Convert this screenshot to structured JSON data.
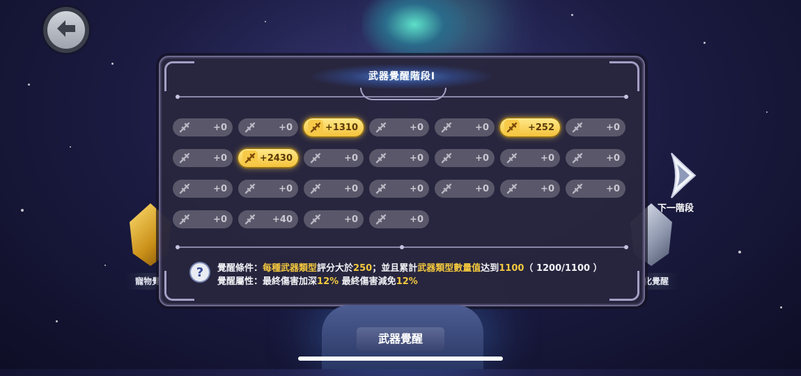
{
  "header": {
    "back_icon": "back-arrow-icon"
  },
  "panel": {
    "title": "武器覺醒階段I",
    "weapons": [
      {
        "icon": "sword-icon",
        "value": "+0",
        "active": false
      },
      {
        "icon": "dual-blades-icon",
        "value": "+0",
        "active": false
      },
      {
        "icon": "whip-icon",
        "value": "+1310",
        "active": true
      },
      {
        "icon": "hammer-icon",
        "value": "+0",
        "active": false
      },
      {
        "icon": "wand-icon",
        "value": "+0",
        "active": false
      },
      {
        "icon": "spellbook-icon",
        "value": "+252",
        "active": true
      },
      {
        "icon": "rifle-icon",
        "value": "+0",
        "active": false
      },
      {
        "icon": "greatsword-icon",
        "value": "+0",
        "active": false
      },
      {
        "icon": "shield-icon",
        "value": "+2430",
        "active": true
      },
      {
        "icon": "gauntlet-icon",
        "value": "+0",
        "active": false
      },
      {
        "icon": "cannon-icon",
        "value": "+0",
        "active": false
      },
      {
        "icon": "dagger-icon",
        "value": "+0",
        "active": false
      },
      {
        "icon": "dice-icon",
        "value": "+0",
        "active": false
      },
      {
        "icon": "spear-icon",
        "value": "+0",
        "active": false
      },
      {
        "icon": "flail-icon",
        "value": "+0",
        "active": false
      },
      {
        "icon": "bow-icon",
        "value": "+0",
        "active": false
      },
      {
        "icon": "scepter-icon",
        "value": "+0",
        "active": false
      },
      {
        "icon": "crossbow-icon",
        "value": "+0",
        "active": false
      },
      {
        "icon": "fist-icon",
        "value": "+0",
        "active": false
      },
      {
        "icon": "orb-icon",
        "value": "+0",
        "active": false
      },
      {
        "icon": "guitar-icon",
        "value": "+0",
        "active": false
      },
      {
        "icon": "rope-dart-icon",
        "value": "+0",
        "active": false
      },
      {
        "icon": "shuriken-icon",
        "value": "+40",
        "active": false
      },
      {
        "icon": "twin-daggers-icon",
        "value": "+0",
        "active": false
      },
      {
        "icon": "gatling-icon",
        "value": "+0",
        "active": false
      }
    ],
    "condition": {
      "label": "覺醒條件：",
      "hl1": "每種武器類型",
      "t1": "評分大於",
      "hl2": "250",
      "t2": "；並且累計",
      "hl3": "武器類型數量值",
      "t3": "达到",
      "hl4": "1100",
      "t4": "（ 1200/1100 ）"
    },
    "attribute": {
      "label": "覺醒屬性：",
      "t1": "最終傷害加深",
      "hl1": "12%",
      "t2": " 最終傷害減免",
      "hl2": "12%"
    }
  },
  "next_stage": {
    "label": "下一階段"
  },
  "bottom": {
    "label": "武器覺醒"
  },
  "side_labels": {
    "left": "寵物覺",
    "right": "化覺醒"
  },
  "colors": {
    "highlight": "#f5c93e",
    "panel": "#28263e",
    "pill_active": "#f4c23a",
    "pill": "#595769"
  }
}
